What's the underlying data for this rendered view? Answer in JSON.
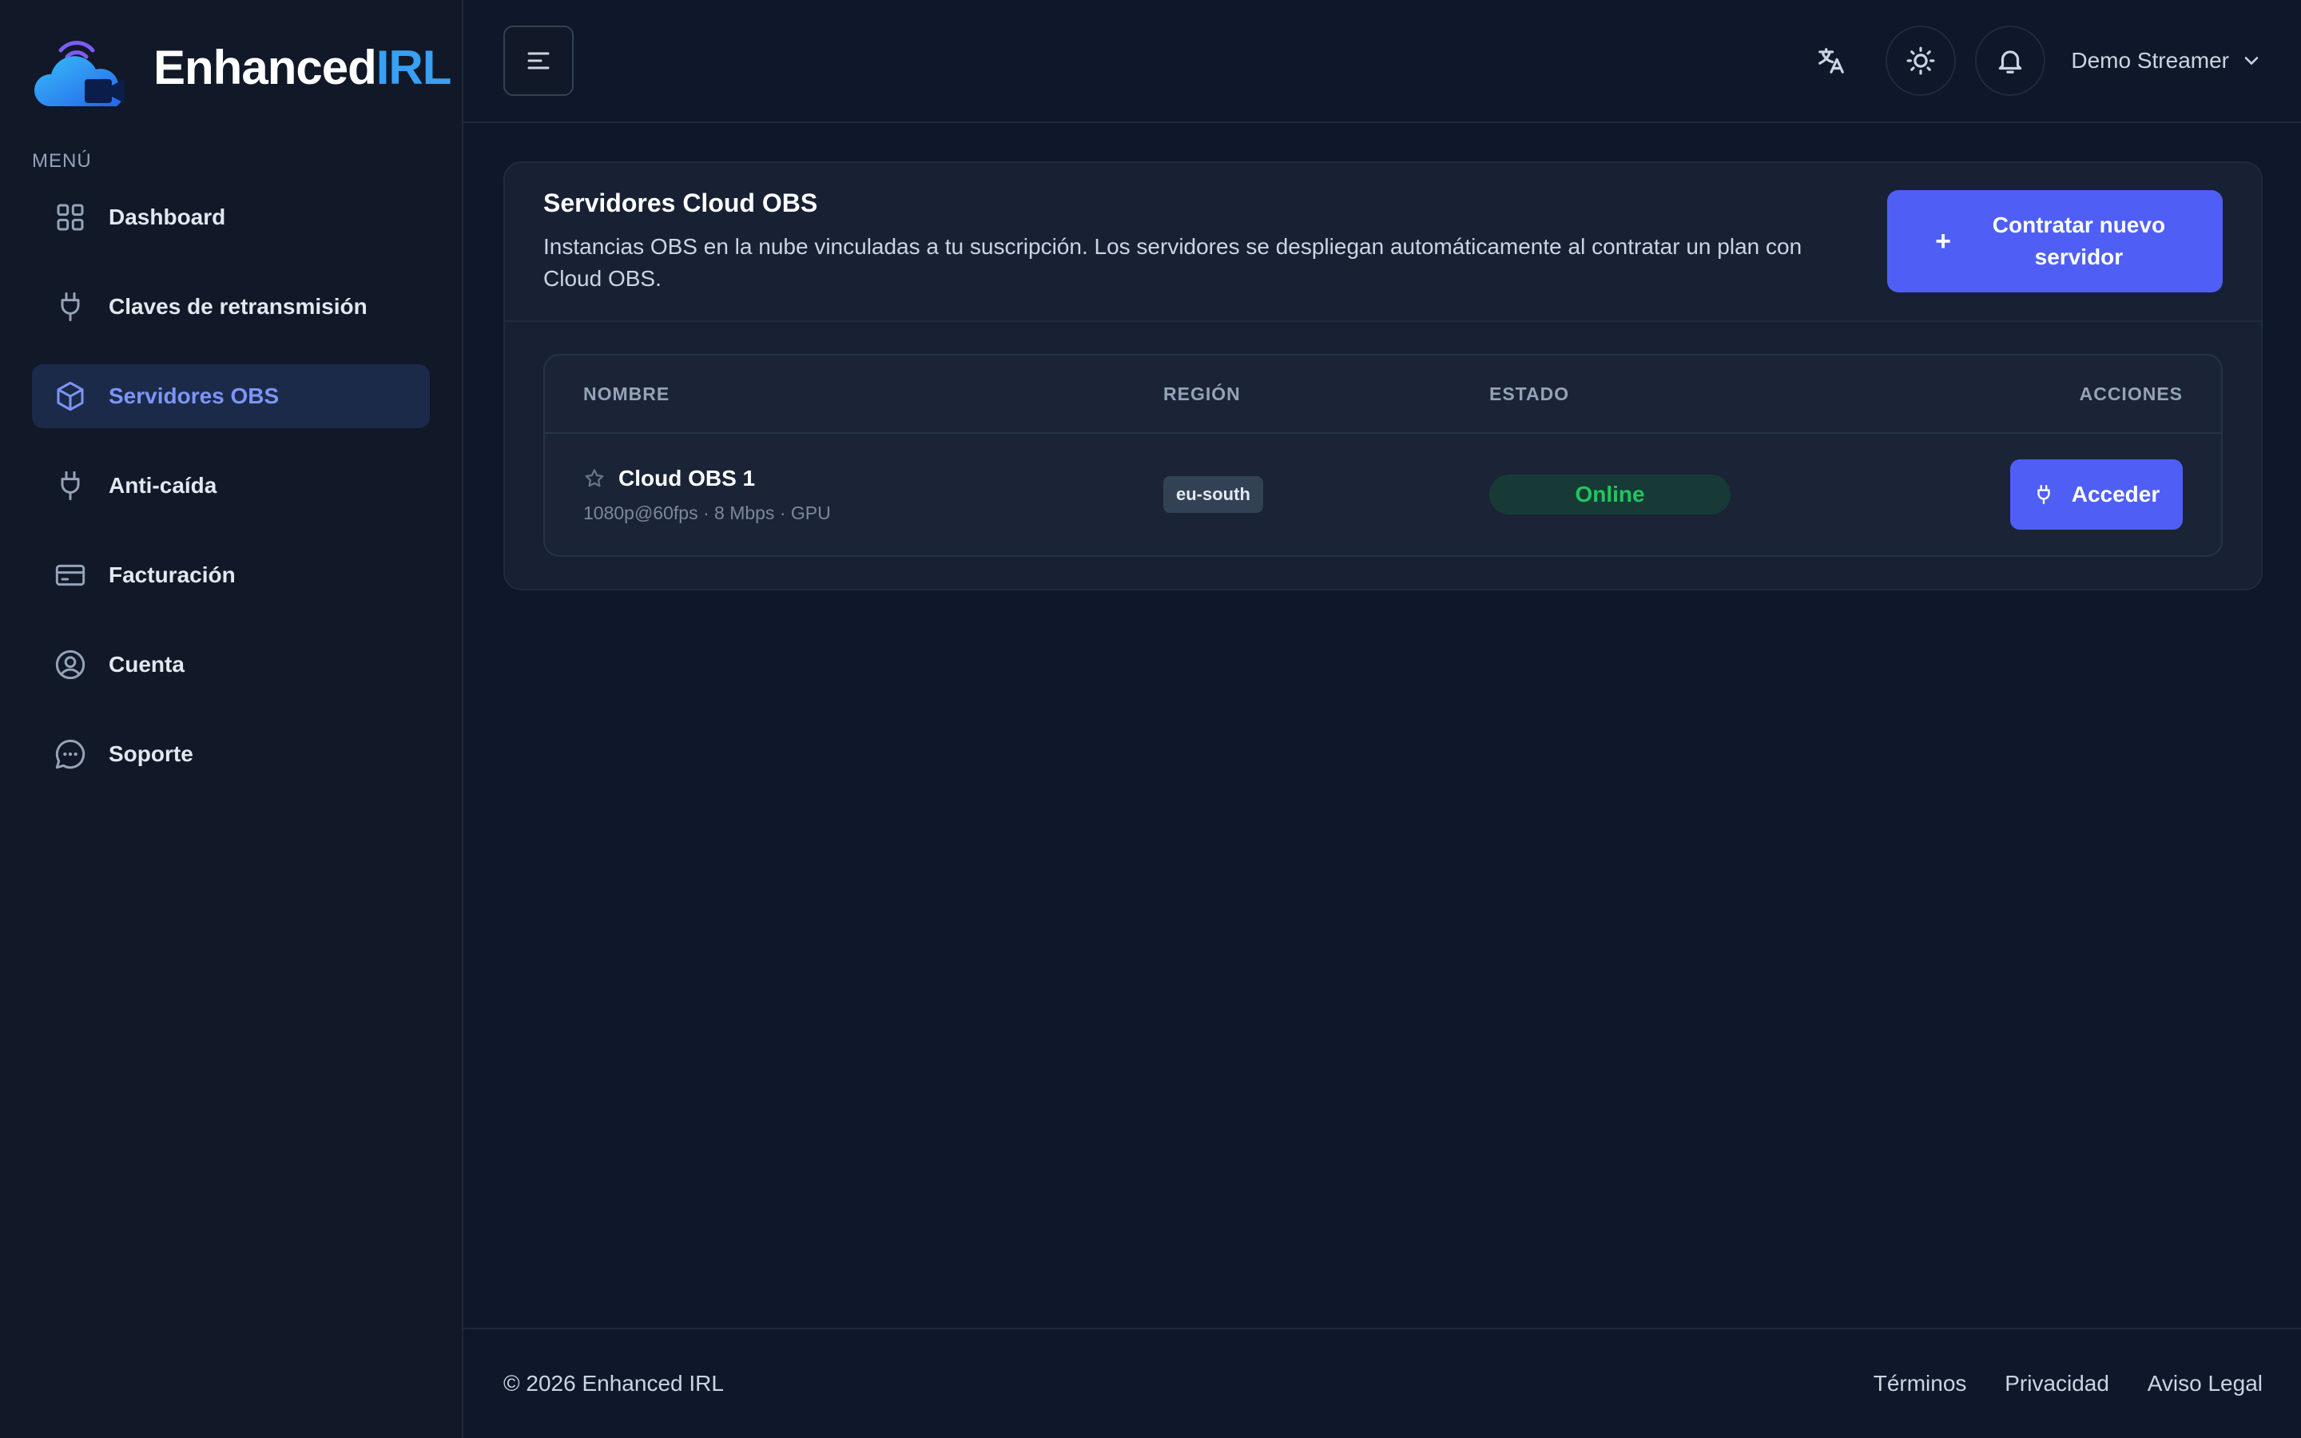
{
  "brand": {
    "name_part1": "Enhanced",
    "name_part2": "IRL"
  },
  "sidebar": {
    "menu_label": "MENÚ",
    "items": [
      {
        "label": "Dashboard",
        "icon": "grid-icon",
        "active": false
      },
      {
        "label": "Claves de retransmisión",
        "icon": "plug-icon",
        "active": false
      },
      {
        "label": "Servidores OBS",
        "icon": "cube-icon",
        "active": true
      },
      {
        "label": "Anti-caída",
        "icon": "plug-icon",
        "active": false
      },
      {
        "label": "Facturación",
        "icon": "credit-card-icon",
        "active": false
      },
      {
        "label": "Cuenta",
        "icon": "user-circle-icon",
        "active": false
      },
      {
        "label": "Soporte",
        "icon": "chat-icon",
        "active": false
      }
    ]
  },
  "header": {
    "user_name": "Demo Streamer"
  },
  "card": {
    "title": "Servidores Cloud OBS",
    "description": "Instancias OBS en la nube vinculadas a tu suscripción. Los servidores se despliegan automáticamente al contratar un plan con Cloud OBS.",
    "new_button_label": "Contratar nuevo servidor"
  },
  "table": {
    "columns": {
      "name": "NOMBRE",
      "region": "REGIÓN",
      "state": "ESTADO",
      "actions": "ACCIONES"
    },
    "rows": [
      {
        "name": "Cloud OBS 1",
        "specs": "1080p@60fps · 8 Mbps · GPU",
        "region": "eu-south",
        "status": "Online",
        "action_label": "Acceder"
      }
    ]
  },
  "footer": {
    "copyright": "© 2026 Enhanced IRL",
    "links": [
      "Términos",
      "Privacidad",
      "Aviso Legal"
    ]
  },
  "colors": {
    "accent": "#4f5ff5",
    "background": "#0f172a",
    "status_online": "#22c55e"
  }
}
